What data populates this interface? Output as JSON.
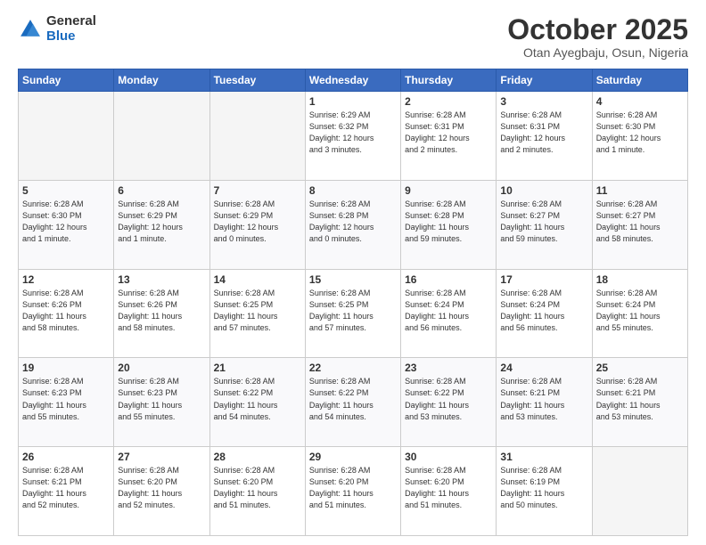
{
  "logo": {
    "general": "General",
    "blue": "Blue"
  },
  "header": {
    "month": "October 2025",
    "location": "Otan Ayegbaju, Osun, Nigeria"
  },
  "weekdays": [
    "Sunday",
    "Monday",
    "Tuesday",
    "Wednesday",
    "Thursday",
    "Friday",
    "Saturday"
  ],
  "weeks": [
    [
      {
        "day": "",
        "info": ""
      },
      {
        "day": "",
        "info": ""
      },
      {
        "day": "",
        "info": ""
      },
      {
        "day": "1",
        "info": "Sunrise: 6:29 AM\nSunset: 6:32 PM\nDaylight: 12 hours\nand 3 minutes."
      },
      {
        "day": "2",
        "info": "Sunrise: 6:28 AM\nSunset: 6:31 PM\nDaylight: 12 hours\nand 2 minutes."
      },
      {
        "day": "3",
        "info": "Sunrise: 6:28 AM\nSunset: 6:31 PM\nDaylight: 12 hours\nand 2 minutes."
      },
      {
        "day": "4",
        "info": "Sunrise: 6:28 AM\nSunset: 6:30 PM\nDaylight: 12 hours\nand 1 minute."
      }
    ],
    [
      {
        "day": "5",
        "info": "Sunrise: 6:28 AM\nSunset: 6:30 PM\nDaylight: 12 hours\nand 1 minute."
      },
      {
        "day": "6",
        "info": "Sunrise: 6:28 AM\nSunset: 6:29 PM\nDaylight: 12 hours\nand 1 minute."
      },
      {
        "day": "7",
        "info": "Sunrise: 6:28 AM\nSunset: 6:29 PM\nDaylight: 12 hours\nand 0 minutes."
      },
      {
        "day": "8",
        "info": "Sunrise: 6:28 AM\nSunset: 6:28 PM\nDaylight: 12 hours\nand 0 minutes."
      },
      {
        "day": "9",
        "info": "Sunrise: 6:28 AM\nSunset: 6:28 PM\nDaylight: 11 hours\nand 59 minutes."
      },
      {
        "day": "10",
        "info": "Sunrise: 6:28 AM\nSunset: 6:27 PM\nDaylight: 11 hours\nand 59 minutes."
      },
      {
        "day": "11",
        "info": "Sunrise: 6:28 AM\nSunset: 6:27 PM\nDaylight: 11 hours\nand 58 minutes."
      }
    ],
    [
      {
        "day": "12",
        "info": "Sunrise: 6:28 AM\nSunset: 6:26 PM\nDaylight: 11 hours\nand 58 minutes."
      },
      {
        "day": "13",
        "info": "Sunrise: 6:28 AM\nSunset: 6:26 PM\nDaylight: 11 hours\nand 58 minutes."
      },
      {
        "day": "14",
        "info": "Sunrise: 6:28 AM\nSunset: 6:25 PM\nDaylight: 11 hours\nand 57 minutes."
      },
      {
        "day": "15",
        "info": "Sunrise: 6:28 AM\nSunset: 6:25 PM\nDaylight: 11 hours\nand 57 minutes."
      },
      {
        "day": "16",
        "info": "Sunrise: 6:28 AM\nSunset: 6:24 PM\nDaylight: 11 hours\nand 56 minutes."
      },
      {
        "day": "17",
        "info": "Sunrise: 6:28 AM\nSunset: 6:24 PM\nDaylight: 11 hours\nand 56 minutes."
      },
      {
        "day": "18",
        "info": "Sunrise: 6:28 AM\nSunset: 6:24 PM\nDaylight: 11 hours\nand 55 minutes."
      }
    ],
    [
      {
        "day": "19",
        "info": "Sunrise: 6:28 AM\nSunset: 6:23 PM\nDaylight: 11 hours\nand 55 minutes."
      },
      {
        "day": "20",
        "info": "Sunrise: 6:28 AM\nSunset: 6:23 PM\nDaylight: 11 hours\nand 55 minutes."
      },
      {
        "day": "21",
        "info": "Sunrise: 6:28 AM\nSunset: 6:22 PM\nDaylight: 11 hours\nand 54 minutes."
      },
      {
        "day": "22",
        "info": "Sunrise: 6:28 AM\nSunset: 6:22 PM\nDaylight: 11 hours\nand 54 minutes."
      },
      {
        "day": "23",
        "info": "Sunrise: 6:28 AM\nSunset: 6:22 PM\nDaylight: 11 hours\nand 53 minutes."
      },
      {
        "day": "24",
        "info": "Sunrise: 6:28 AM\nSunset: 6:21 PM\nDaylight: 11 hours\nand 53 minutes."
      },
      {
        "day": "25",
        "info": "Sunrise: 6:28 AM\nSunset: 6:21 PM\nDaylight: 11 hours\nand 53 minutes."
      }
    ],
    [
      {
        "day": "26",
        "info": "Sunrise: 6:28 AM\nSunset: 6:21 PM\nDaylight: 11 hours\nand 52 minutes."
      },
      {
        "day": "27",
        "info": "Sunrise: 6:28 AM\nSunset: 6:20 PM\nDaylight: 11 hours\nand 52 minutes."
      },
      {
        "day": "28",
        "info": "Sunrise: 6:28 AM\nSunset: 6:20 PM\nDaylight: 11 hours\nand 51 minutes."
      },
      {
        "day": "29",
        "info": "Sunrise: 6:28 AM\nSunset: 6:20 PM\nDaylight: 11 hours\nand 51 minutes."
      },
      {
        "day": "30",
        "info": "Sunrise: 6:28 AM\nSunset: 6:20 PM\nDaylight: 11 hours\nand 51 minutes."
      },
      {
        "day": "31",
        "info": "Sunrise: 6:28 AM\nSunset: 6:19 PM\nDaylight: 11 hours\nand 50 minutes."
      },
      {
        "day": "",
        "info": ""
      }
    ]
  ]
}
